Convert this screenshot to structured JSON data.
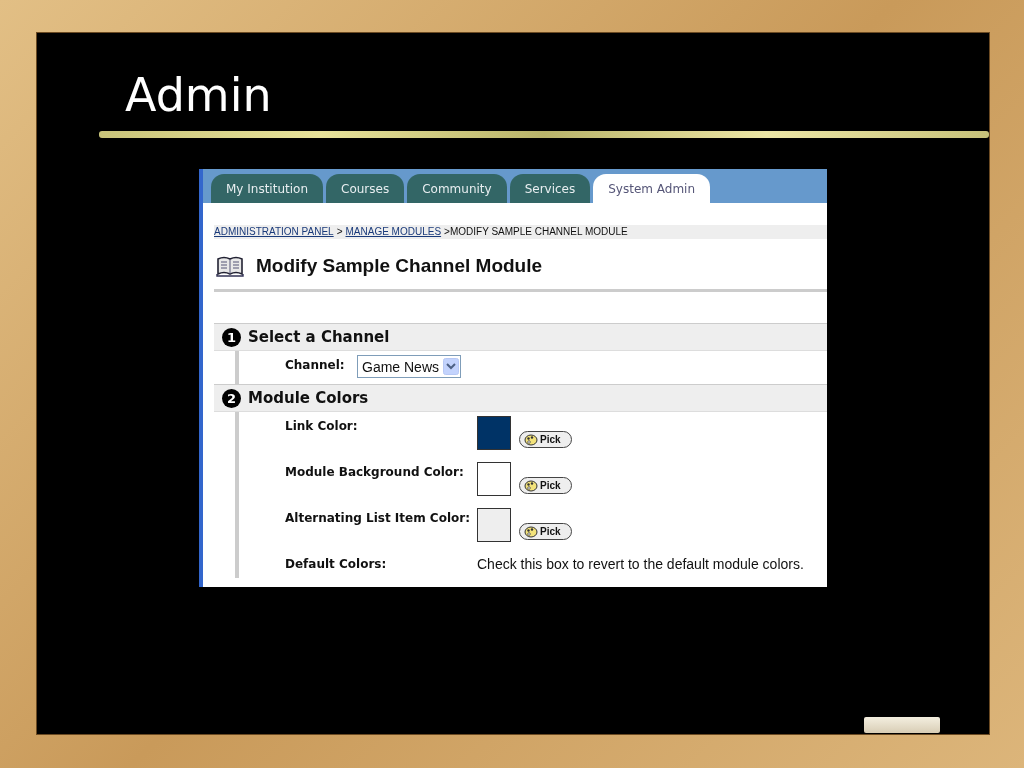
{
  "slide": {
    "title": "Admin"
  },
  "tabs": [
    {
      "label": "My Institution",
      "selected": false
    },
    {
      "label": "Courses",
      "selected": false
    },
    {
      "label": "Community",
      "selected": false
    },
    {
      "label": "Services",
      "selected": false
    },
    {
      "label": "System Admin",
      "selected": true
    }
  ],
  "breadcrumb": {
    "links": [
      "ADMINISTRATION PANEL",
      "MANAGE MODULES"
    ],
    "separator": ">",
    "current": ">MODIFY SAMPLE CHANNEL MODULE"
  },
  "page_title": "Modify Sample Channel Module",
  "sections": [
    {
      "number": "1",
      "title": "Select a Channel",
      "fields": [
        {
          "kind": "select",
          "label": "Channel:",
          "value": "Game News"
        }
      ]
    },
    {
      "number": "2",
      "title": "Module Colors",
      "fields": [
        {
          "kind": "color",
          "label": "Link Color:",
          "color": "#003366",
          "button": "Pick"
        },
        {
          "kind": "color",
          "label": "Module Background Color:",
          "color": "#ffffff",
          "button": "Pick"
        },
        {
          "kind": "color",
          "label": "Alternating List Item Color:",
          "color": "#eeeeee",
          "button": "Pick"
        },
        {
          "kind": "text",
          "label": "Default Colors:",
          "text": "Check this box to revert to the default module colors."
        }
      ]
    }
  ]
}
